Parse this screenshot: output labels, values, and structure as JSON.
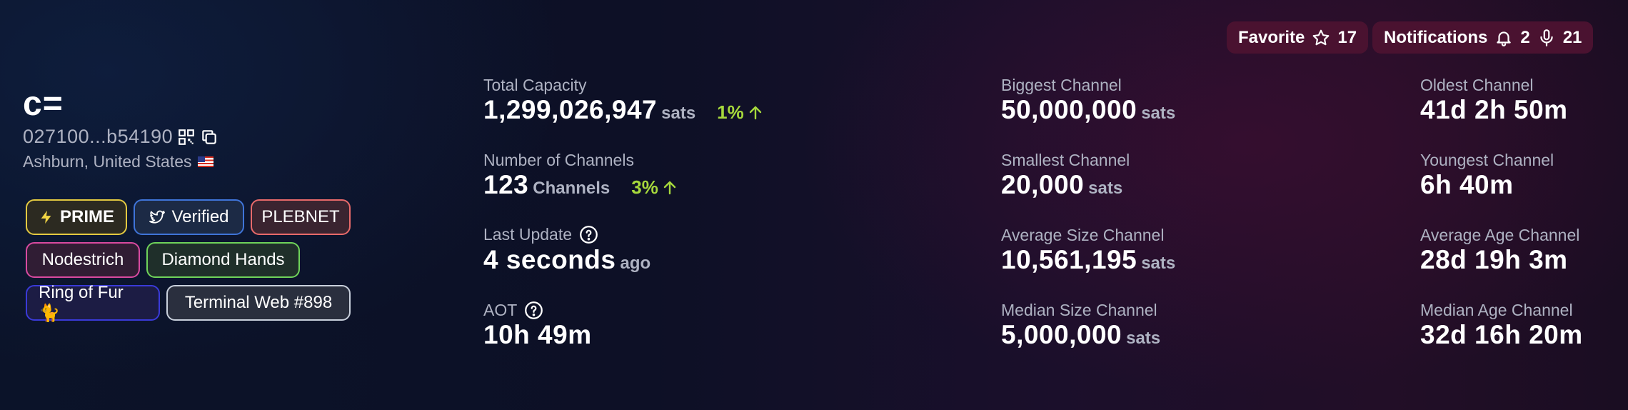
{
  "header": {
    "favorite": {
      "label": "Favorite",
      "count": "17"
    },
    "notifications": {
      "label": "Notifications",
      "bell_count": "2",
      "mic_count": "21"
    }
  },
  "node": {
    "alias": "c=",
    "pubkey": "027100...b54190",
    "location": "Ashburn, United States"
  },
  "badges": {
    "prime": "PRIME",
    "verified": "Verified",
    "plebnet": "PLEBNET",
    "nodestrich": "Nodestrich",
    "diamond_hands": "Diamond Hands",
    "ring_of_fur": "Ring of Fur 🐈",
    "terminal": "Terminal Web #898"
  },
  "stats": {
    "total_capacity": {
      "label": "Total Capacity",
      "value": "1,299,026,947",
      "unit": "sats",
      "change": "1%"
    },
    "num_channels": {
      "label": "Number of Channels",
      "value": "123",
      "unit": "Channels",
      "change": "3%"
    },
    "last_update": {
      "label": "Last Update",
      "value": "4 seconds",
      "unit": "ago"
    },
    "aot": {
      "label": "AOT",
      "value": "10h 49m"
    },
    "biggest_channel": {
      "label": "Biggest Channel",
      "value": "50,000,000",
      "unit": "sats"
    },
    "smallest_channel": {
      "label": "Smallest Channel",
      "value": "20,000",
      "unit": "sats"
    },
    "avg_size_channel": {
      "label": "Average Size Channel",
      "value": "10,561,195",
      "unit": "sats"
    },
    "median_size_channel": {
      "label": "Median Size Channel",
      "value": "5,000,000",
      "unit": "sats"
    },
    "oldest_channel": {
      "label": "Oldest Channel",
      "value": "41d 2h 50m"
    },
    "youngest_channel": {
      "label": "Youngest Channel",
      "value": "6h 40m"
    },
    "avg_age_channel": {
      "label": "Average Age Channel",
      "value": "28d 19h 3m"
    },
    "median_age_channel": {
      "label": "Median Age Channel",
      "value": "32d 16h 20m"
    }
  },
  "colors": {
    "positive_change": "#a6d83c",
    "pill_bg": "#4a1230",
    "label_gray": "#aeb2c2"
  },
  "icons": [
    "star-icon",
    "bell-icon",
    "mic-icon",
    "qr-icon",
    "copy-icon",
    "flag-icon",
    "lightning-icon",
    "twitter-icon",
    "arrow-up-icon",
    "help-icon"
  ]
}
